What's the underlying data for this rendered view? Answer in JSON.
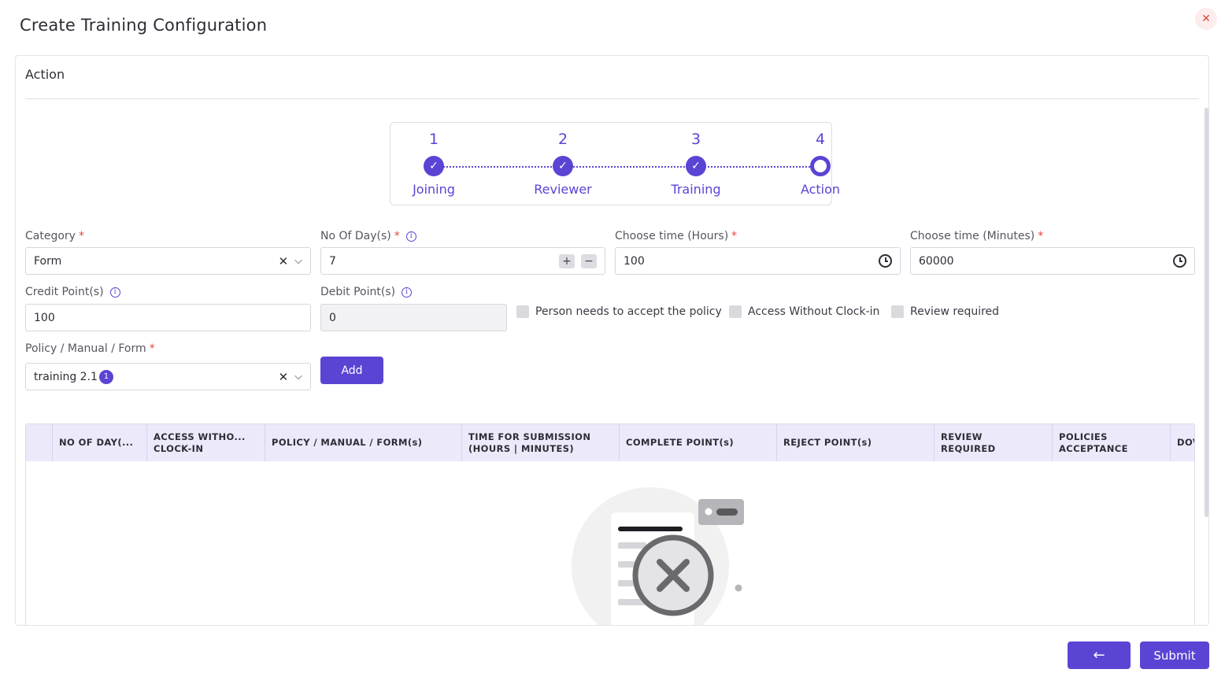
{
  "modal": {
    "title": "Create Training Configuration",
    "close_icon": "close-icon",
    "close_color": "#e0473f"
  },
  "panel": {
    "title": "Action"
  },
  "stepper": {
    "steps": [
      {
        "number": "1",
        "label": "Joining",
        "state": "done"
      },
      {
        "number": "2",
        "label": "Reviewer",
        "state": "done"
      },
      {
        "number": "3",
        "label": "Training",
        "state": "done"
      },
      {
        "number": "4",
        "label": "Action",
        "state": "current"
      }
    ],
    "accent": "#5a44d4"
  },
  "form": {
    "category": {
      "label": "Category",
      "value": "Form",
      "required": "*"
    },
    "no_of_days": {
      "label": "No Of Day(s)",
      "value": "7",
      "required": "*"
    },
    "hours": {
      "label": "Choose time (Hours)",
      "value": "100",
      "required": "*"
    },
    "minutes": {
      "label": "Choose time (Minutes)",
      "value": "60000",
      "required": "*"
    },
    "credit_points": {
      "label": "Credit Point(s)",
      "value": "100"
    },
    "debit_points": {
      "label": "Debit Point(s)",
      "value": "0"
    },
    "checkboxes": [
      {
        "label": "Person needs to accept the policy",
        "checked": false
      },
      {
        "label": "Access Without Clock-in",
        "checked": false
      },
      {
        "label": "Review required",
        "checked": false
      }
    ],
    "policy": {
      "label": "Policy / Manual / Form",
      "value": "training 2.1",
      "count": "1",
      "required": "*"
    },
    "add_label": "Add"
  },
  "table": {
    "columns": [
      "",
      "NO OF DAY(...",
      "ACCESS WITHO...\nCLOCK-IN",
      "POLICY / MANUAL / FORM(s)",
      "TIME FOR SUBMISSION\n(HOURS | MINUTES)",
      "COMPLETE POINT(s)",
      "REJECT POINT(s)",
      "REVIEW\nREQUIRED",
      "POLICIES\nACCEPTANCE",
      "DOV"
    ],
    "rows": []
  },
  "footer": {
    "back_icon": "arrow-left-icon",
    "back_label": "←",
    "submit_label": "Submit"
  }
}
